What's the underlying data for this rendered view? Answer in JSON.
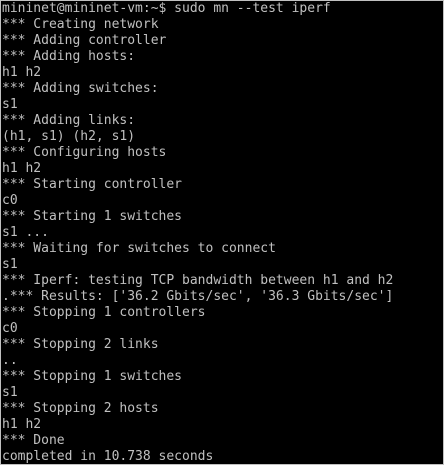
{
  "terminal": {
    "lines": [
      "mininet@mininet-vm:~$ sudo mn --test iperf",
      "*** Creating network",
      "*** Adding controller",
      "*** Adding hosts:",
      "h1 h2",
      "*** Adding switches:",
      "s1",
      "*** Adding links:",
      "(h1, s1) (h2, s1)",
      "*** Configuring hosts",
      "h1 h2",
      "*** Starting controller",
      "c0",
      "*** Starting 1 switches",
      "s1 ...",
      "*** Waiting for switches to connect",
      "s1",
      "*** Iperf: testing TCP bandwidth between h1 and h2",
      ".*** Results: ['36.2 Gbits/sec', '36.3 Gbits/sec']",
      "*** Stopping 1 controllers",
      "c0",
      "*** Stopping 2 links",
      "..",
      "*** Stopping 1 switches",
      "s1",
      "*** Stopping 2 hosts",
      "h1 h2",
      "*** Done",
      "completed in 10.738 seconds"
    ]
  }
}
